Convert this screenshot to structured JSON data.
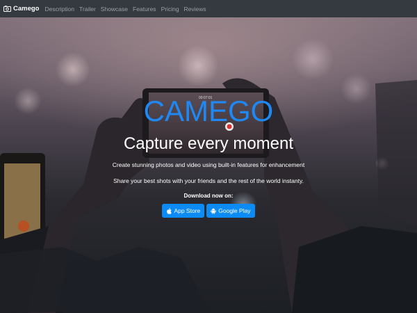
{
  "navbar": {
    "brand": "Camego",
    "links": [
      "Description",
      "Trailer",
      "Showcase",
      "Features",
      "Pricing",
      "Reviews"
    ]
  },
  "hero": {
    "logo_text": "CAMEGO",
    "tagline": "Capture every moment",
    "line1": "Create stunning photos and video using built-in features for enhancement",
    "line2": "Share your best shots with your friends and the rest of the world instanty.",
    "download_label": "Download now on:",
    "phone_time": "00:07:01"
  },
  "buttons": {
    "app_store": "App Store",
    "google_play": "Google Play"
  },
  "colors": {
    "accent": "#1e88f5",
    "button": "#0d8bf5",
    "navbar": "#343a40"
  }
}
